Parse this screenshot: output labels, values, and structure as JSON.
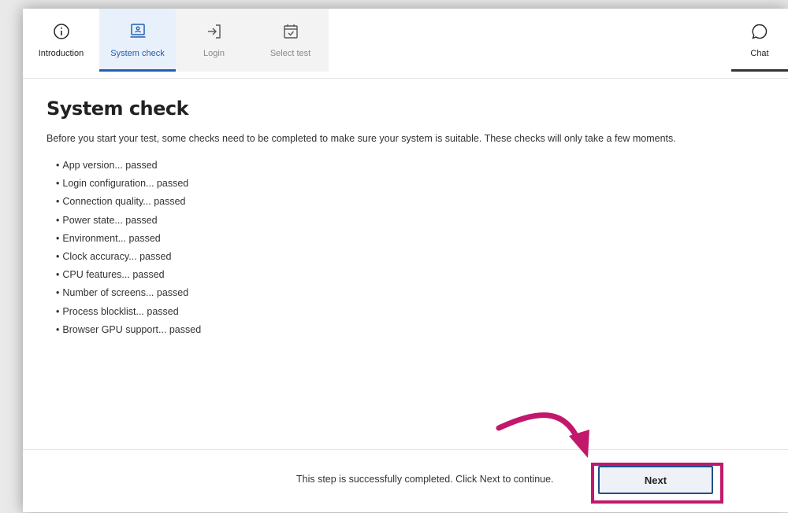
{
  "nav": {
    "tabs": [
      {
        "label": "Introduction",
        "icon": "info-icon",
        "state": "normal"
      },
      {
        "label": "System check",
        "icon": "laptop-icon",
        "state": "active"
      },
      {
        "label": "Login",
        "icon": "login-icon",
        "state": "disabled"
      },
      {
        "label": "Select test",
        "icon": "calendar-icon",
        "state": "disabled"
      }
    ],
    "chat_label": "Chat"
  },
  "page": {
    "title": "System check",
    "intro": "Before you start your test, some checks need to be completed to make sure your system is suitable. These checks will only take a few moments.",
    "checks": [
      "App version... passed",
      "Login configuration... passed",
      "Connection quality... passed",
      "Power state... passed",
      "Environment... passed",
      "Clock accuracy... passed",
      "CPU features... passed",
      "Number of screens... passed",
      "Process blocklist... passed",
      "Browser GPU support... passed"
    ]
  },
  "footer": {
    "status": "This step is successfully completed. Click Next to continue.",
    "next_label": "Next"
  },
  "colors": {
    "accent": "#1f5fb3",
    "highlight": "#c2186b"
  }
}
